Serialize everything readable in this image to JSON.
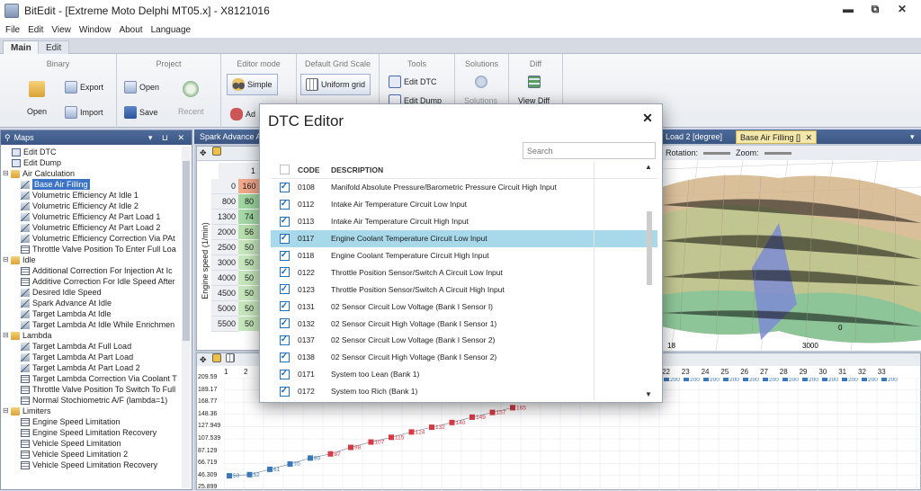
{
  "window": {
    "title": "BitEdit - [Extreme Moto Delphi MT05.x] - X8121016",
    "controls": [
      "▬",
      "⧉",
      "✕"
    ]
  },
  "menu": [
    "File",
    "Edit",
    "View",
    "Window",
    "About",
    "Language"
  ],
  "ribbon_tabs": [
    "Main",
    "Edit"
  ],
  "ribbon": {
    "binary": {
      "title": "Binary",
      "open": "Open",
      "export": "Export",
      "import": "Import"
    },
    "project": {
      "title": "Project",
      "open": "Open",
      "save": "Save",
      "recent": "Recent"
    },
    "editor_mode": {
      "title": "Editor mode",
      "simple": "Simple",
      "advanced": "Ad"
    },
    "grid_scale": {
      "title": "Default Grid Scale",
      "uniform": "Uniform grid"
    },
    "tools": {
      "title": "Tools",
      "edit_dtc": "Edit DTC",
      "edit_dump": "Edit Dump"
    },
    "solutions": {
      "title": "Solutions",
      "solutions": "Solutions"
    },
    "diff": {
      "title": "Diff",
      "view_diff": "View Diff"
    }
  },
  "maps_panel": {
    "title": "Maps",
    "header_icons": "▾ ⊔ ✕",
    "tree": [
      {
        "label": "Edit DTC",
        "icon": "dtc",
        "indent": 1
      },
      {
        "label": "Edit Dump",
        "icon": "dtc",
        "indent": 1
      },
      {
        "label": "Air Calculation",
        "icon": "folder",
        "indent": 0,
        "exp": "⊟"
      },
      {
        "label": "Base Air Filling",
        "icon": "map",
        "indent": 2,
        "selected": true
      },
      {
        "label": "Volumetric Efficiency At Idle 1",
        "icon": "map",
        "indent": 2
      },
      {
        "label": "Volumetric Efficiency At Idle 2",
        "icon": "map",
        "indent": 2
      },
      {
        "label": "Volumetric Efficiency At Part Load 1",
        "icon": "map",
        "indent": 2
      },
      {
        "label": "Volumetric Efficiency At Part Load 2",
        "icon": "map",
        "indent": 2
      },
      {
        "label": "Volumetric Efficiency Correction Via PAt",
        "icon": "map",
        "indent": 2
      },
      {
        "label": "Throttle Valve Position To Enter Full Loa",
        "icon": "tbl",
        "indent": 2
      },
      {
        "label": "Idle",
        "icon": "folder",
        "indent": 0,
        "exp": "⊟"
      },
      {
        "label": "Additional Correction For Injection At Ic",
        "icon": "tbl",
        "indent": 2
      },
      {
        "label": "Additive Correction For Idle Speed After",
        "icon": "tbl",
        "indent": 2
      },
      {
        "label": "Desired Idle Speed",
        "icon": "map",
        "indent": 2
      },
      {
        "label": "Spark Advance At Idle",
        "icon": "map",
        "indent": 2
      },
      {
        "label": "Target Lambda At Idle",
        "icon": "map",
        "indent": 2
      },
      {
        "label": "Target Lambda At Idle While Enrichmen",
        "icon": "map",
        "indent": 2
      },
      {
        "label": "Lambda",
        "icon": "folder",
        "indent": 0,
        "exp": "⊟"
      },
      {
        "label": "Target Lambda At Full Load",
        "icon": "map",
        "indent": 2
      },
      {
        "label": "Target Lambda At Part Load",
        "icon": "map",
        "indent": 2
      },
      {
        "label": "Target Lambda At Part Load 2",
        "icon": "map",
        "indent": 2
      },
      {
        "label": "Target Lambda Correction Via Coolant T",
        "icon": "tbl",
        "indent": 2
      },
      {
        "label": "Throttle Valve Position To Switch To Full",
        "icon": "tbl",
        "indent": 2
      },
      {
        "label": "Normal Stochiometric A/F (lambda=1)",
        "icon": "tbl",
        "indent": 2
      },
      {
        "label": "Limiters",
        "icon": "folder",
        "indent": 0,
        "exp": "⊟"
      },
      {
        "label": "Engine Speed Limitation",
        "icon": "tbl",
        "indent": 2
      },
      {
        "label": "Engine Speed Limitation Recovery",
        "icon": "tbl",
        "indent": 2
      },
      {
        "label": "Vehicle Speed Limitation",
        "icon": "tbl",
        "indent": 2
      },
      {
        "label": "Vehicle Speed Limitation 2",
        "icon": "tbl",
        "indent": 2
      },
      {
        "label": "Vehicle Speed Limitation Recovery",
        "icon": "tbl",
        "indent": 2
      }
    ]
  },
  "doc_tabs": {
    "left": "Spark Advance At",
    "mid": "Load 2 [degree]",
    "active": "Base Air Filling []",
    "close": "✕",
    "menu": "▾"
  },
  "grid": {
    "corner": "0",
    "col1": "1",
    "axis_label": "Engine speed (1/min)",
    "rows": [
      {
        "rpm": "0",
        "v": "160"
      },
      {
        "rpm": "800",
        "v": "80"
      },
      {
        "rpm": "1300",
        "v": "74"
      },
      {
        "rpm": "2000",
        "v": "56"
      },
      {
        "rpm": "2500",
        "v": "50"
      },
      {
        "rpm": "3000",
        "v": "50"
      },
      {
        "rpm": "4000",
        "v": "50"
      },
      {
        "rpm": "4500",
        "v": "50"
      },
      {
        "rpm": "5000",
        "v": "50"
      },
      {
        "rpm": "5500",
        "v": "50"
      }
    ]
  },
  "graph3d": {
    "rotation_label": "Rotation:",
    "zoom_label": "Zoom:",
    "axis_18": "18",
    "axis_3000": "3000",
    "axis_0": "0"
  },
  "plot2d": {
    "cols": [
      "1",
      "2",
      "22",
      "23",
      "24",
      "25",
      "26",
      "27",
      "28",
      "29",
      "30",
      "31",
      "32",
      "33"
    ],
    "ylabels": [
      "209.59",
      "189.17",
      "168.77",
      "148.36",
      "127.949",
      "107.539",
      "87.129",
      "66.719",
      "46.309",
      "25.899"
    ],
    "point_labels": [
      "50",
      "52",
      "61",
      "70",
      "80",
      "87",
      "98",
      "107",
      "115",
      "124",
      "132",
      "140",
      "149",
      "157",
      "165"
    ],
    "top_value": "200"
  },
  "dtc_editor": {
    "title": "DTC Editor",
    "close": "✕",
    "search_placeholder": "Search",
    "headers": {
      "code": "CODE",
      "description": "DESCRIPTION"
    },
    "rows": [
      {
        "code": "0108",
        "description": "Manifold Absolute Pressure/Barometric Pressure Circuit High Input",
        "checked": true
      },
      {
        "code": "0112",
        "description": "Intake Air Temperature Circuit Low Input",
        "checked": true
      },
      {
        "code": "0113",
        "description": "Intake Air Temperature Circuit High Input",
        "checked": true
      },
      {
        "code": "0117",
        "description": "Engine Coolant Temperature Circuit Low Input",
        "checked": true,
        "selected": true
      },
      {
        "code": "0118",
        "description": "Engine Coolant Temperature Circuit High Input",
        "checked": true
      },
      {
        "code": "0122",
        "description": "Throttle Position Sensor/Switch A Circuit Low Input",
        "checked": true
      },
      {
        "code": "0123",
        "description": "Throttle Position Sensor/Switch A Circuit High Input",
        "checked": true
      },
      {
        "code": "0131",
        "description": "02 Sensor Circuit Low Voltage (Bank I Sensor I)",
        "checked": true
      },
      {
        "code": "0132",
        "description": "02 Sensor Circuit High Voltage (Bank I Sensor 1)",
        "checked": true
      },
      {
        "code": "0137",
        "description": "02 Sensor Circuit Low Voltage (Bank I Sensor 2)",
        "checked": true
      },
      {
        "code": "0138",
        "description": "02 Sensor Circuit High Voltage (Bank I Sensor 2)",
        "checked": true
      },
      {
        "code": "0171",
        "description": "System too Lean (Bank 1)",
        "checked": true
      },
      {
        "code": "0172",
        "description": "System too Rich (Bank 1)",
        "checked": true
      }
    ]
  }
}
